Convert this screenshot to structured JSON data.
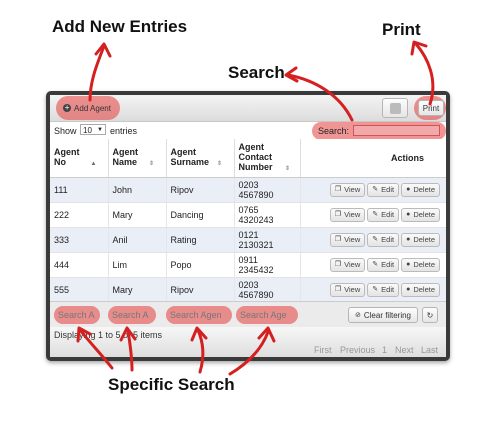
{
  "annotations": {
    "add_new_entries": "Add New Entries",
    "print": "Print",
    "search": "Search",
    "specific_search": "Specific Search"
  },
  "toolbar": {
    "add_agent_label": "Add Agent",
    "print_label": "Print"
  },
  "controls": {
    "show_label": "Show",
    "page_size": "10",
    "entries_label": "entries",
    "search_label": "Search:",
    "search_value": ""
  },
  "table": {
    "headers": [
      "Agent No",
      "Agent Name",
      "Agent Surname",
      "Agent Contact Number",
      "Actions"
    ],
    "rows": [
      {
        "no": "111",
        "name": "John",
        "surname": "Ripov",
        "contact": "0203 4567890"
      },
      {
        "no": "222",
        "name": "Mary",
        "surname": "Dancing",
        "contact": "0765 4320243"
      },
      {
        "no": "333",
        "name": "Anil",
        "surname": "Rating",
        "contact": "0121 2130321"
      },
      {
        "no": "444",
        "name": "Lim",
        "surname": "Popo",
        "contact": "0911 2345432"
      },
      {
        "no": "555",
        "name": "Mary",
        "surname": "Ripov",
        "contact": "0203 4567890"
      }
    ],
    "action_labels": {
      "view": "View",
      "edit": "Edit",
      "delete": "Delete"
    }
  },
  "filters": {
    "placeholders": [
      "Search A",
      "Search A",
      "Search Agen",
      "Search Age"
    ],
    "clear_label": "Clear filtering"
  },
  "footer": {
    "info": "Displaying 1 to 5 of 5 items",
    "pagination": {
      "first": "First",
      "previous": "Previous",
      "page": "1",
      "next": "Next",
      "last": "Last"
    }
  },
  "colors": {
    "highlight": "#e63c3c",
    "arrow": "#d42020",
    "odd_row": "#e9eef7"
  },
  "icons": [
    "add-icon",
    "puzzle-icon",
    "sort-icon",
    "view-icon",
    "edit-icon",
    "delete-icon",
    "clear-icon",
    "refresh-icon"
  ]
}
